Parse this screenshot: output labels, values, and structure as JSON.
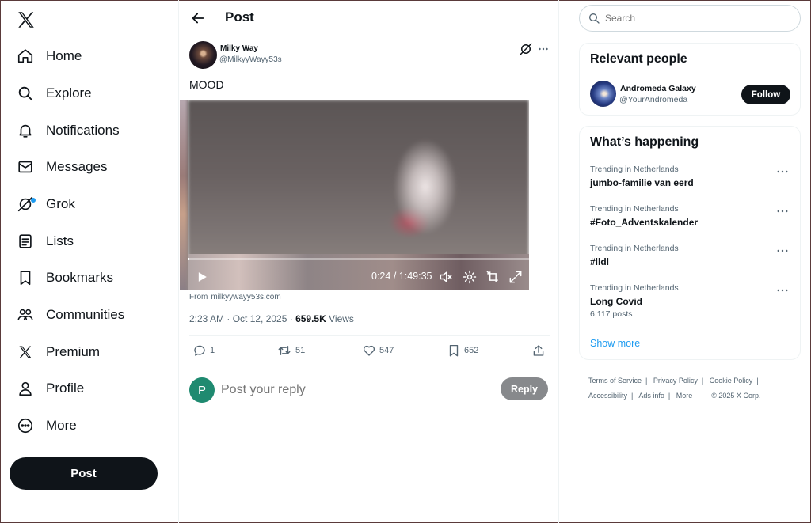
{
  "nav": {
    "items": [
      {
        "label": "Home",
        "icon": "home-icon"
      },
      {
        "label": "Explore",
        "icon": "search-icon"
      },
      {
        "label": "Notifications",
        "icon": "bell-icon"
      },
      {
        "label": "Messages",
        "icon": "envelope-icon"
      },
      {
        "label": "Grok",
        "icon": "grok-icon"
      },
      {
        "label": "Lists",
        "icon": "list-icon"
      },
      {
        "label": "Bookmarks",
        "icon": "bookmark-icon"
      },
      {
        "label": "Communities",
        "icon": "people-icon"
      },
      {
        "label": "Premium",
        "icon": "x-logo-icon"
      },
      {
        "label": "Profile",
        "icon": "person-icon"
      },
      {
        "label": "More",
        "icon": "more-circle-icon"
      }
    ],
    "post_button": "Post"
  },
  "main": {
    "title": "Post",
    "post": {
      "author_name": "Milky Way",
      "author_handle": "@MilkyyWayy53s",
      "text": "MOOD",
      "video": {
        "current_time": "0:24",
        "duration": "1:49:35",
        "progress_fraction": 0.0037
      },
      "from_label": "From",
      "from_domain": "milkyywayy53s.com",
      "time": "2:23 AM · Oct 12, 2025 ·",
      "views_count": "659.5K",
      "views_label": "Views",
      "stats": {
        "replies": "1",
        "reposts": "51",
        "likes": "547",
        "bookmarks": "652"
      }
    },
    "reply": {
      "avatar_letter": "P",
      "placeholder": "Post your reply",
      "button": "Reply"
    }
  },
  "sidebar": {
    "search_placeholder": "Search",
    "relevant": {
      "title": "Relevant people",
      "name": "Andromeda Galaxy",
      "handle": "@YourAndromeda",
      "follow": "Follow"
    },
    "happening": {
      "title": "What’s happening",
      "trends": [
        {
          "context": "Trending in Netherlands",
          "title": "jumbo-familie van eerd",
          "count": ""
        },
        {
          "context": "Trending in Netherlands",
          "title": "#Foto_Adventskalender",
          "count": ""
        },
        {
          "context": "Trending in Netherlands",
          "title": "#lldl",
          "count": ""
        },
        {
          "context": "Trending in Netherlands",
          "title": "Long Covid",
          "count": "6,117 posts"
        }
      ],
      "show_more": "Show more"
    },
    "footer": {
      "links": [
        "Terms of Service",
        "Privacy Policy",
        "Cookie Policy",
        "Accessibility",
        "Ads info",
        "More ···"
      ],
      "copyright": "© 2025 X Corp."
    }
  },
  "colors": {
    "accent": "#1d9bf0",
    "text": "#0f1419",
    "muted": "#536471",
    "button_dark": "#0f1419",
    "reply_avatar": "#1f8a70"
  }
}
